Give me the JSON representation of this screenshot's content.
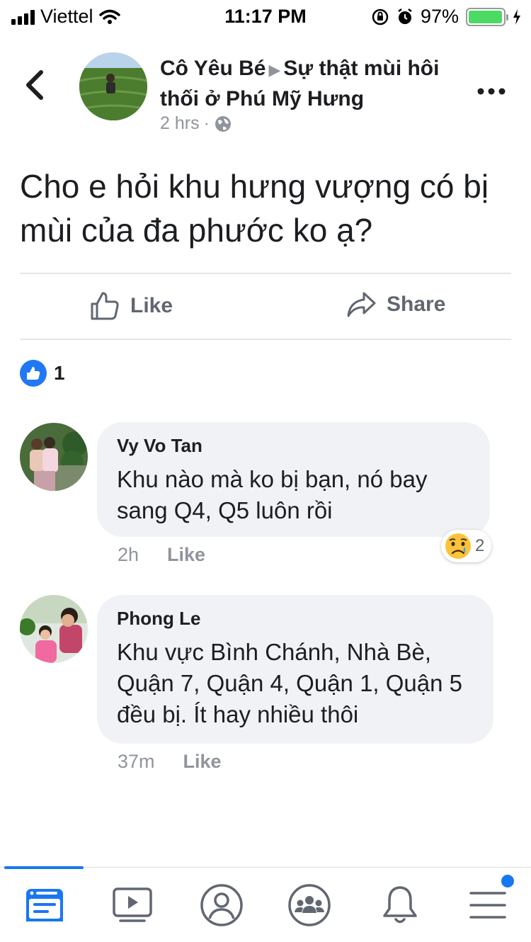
{
  "status_bar": {
    "carrier": "Viettel",
    "time": "11:17 PM",
    "battery_percent": "97%",
    "battery_level": 0.97
  },
  "header": {
    "author": "Cô Yêu Bé",
    "group": "Sự thật mùi hôi thối ở Phú Mỹ Hưng",
    "time": "2 hrs",
    "separator": "·",
    "privacy_icon": "globe-icon",
    "back_icon": "chevron-left-icon",
    "more_icon": "more-dots-icon"
  },
  "post": {
    "text": "Cho e hỏi khu hưng vượng có bị mùi của đa phước ko ạ?",
    "actions": {
      "like": "Like",
      "share": "Share"
    },
    "reaction_count": "1"
  },
  "comments": [
    {
      "name": "Vy Vo Tan",
      "text": "Khu nào mà ko bị bạn, nó bay sang Q4, Q5 luôn rồi",
      "time": "2h",
      "like": "Like",
      "reaction_count": "2",
      "reaction_icon": "sad-emoji-icon"
    },
    {
      "name": "Phong Le",
      "text": "Khu vực Bình Chánh, Nhà Bè, Quận 7, Quận 4, Quận 1, Quận 5 đều bị. Ít hay nhiều thôi",
      "time": "37m",
      "like": "Like"
    }
  ],
  "tab_bar": {
    "tabs": [
      "news-feed-icon",
      "watch-icon",
      "profile-icon",
      "groups-icon",
      "notifications-icon",
      "menu-icon"
    ],
    "active_tab": "news-feed-icon"
  },
  "colors": {
    "facebook_blue": "#1877f2",
    "bubble_bg": "#f0f2f5",
    "secondary_text": "#90949c",
    "battery_green": "#4cd964"
  }
}
